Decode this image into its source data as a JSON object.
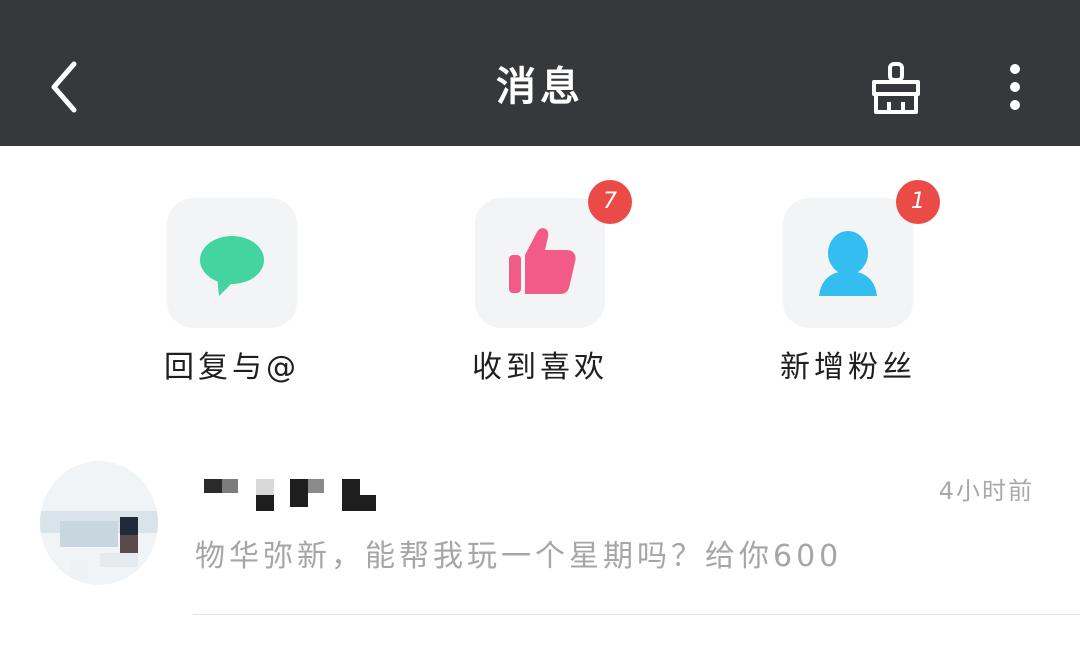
{
  "header": {
    "title": "消息",
    "back_icon": "chevron-left-icon",
    "clean_icon": "broom-icon",
    "more_icon": "more-vertical-icon",
    "background": "#37383c"
  },
  "quick_actions": [
    {
      "label": "回复与@",
      "icon": "chat-bubble-icon",
      "color": "#43d4a2",
      "badge": ""
    },
    {
      "label": "收到喜欢",
      "icon": "thumbs-up-icon",
      "color": "#f25a87",
      "badge": "7"
    },
    {
      "label": "新增粉丝",
      "icon": "user-icon",
      "color": "#33bdf0",
      "badge": "1"
    }
  ],
  "messages": [
    {
      "time": "4小时前",
      "preview": "物华弥新，能帮我玩一个星期吗？给你600"
    }
  ],
  "colors": {
    "badge": "#ea4b46",
    "muted_text": "#a6a6a6"
  }
}
